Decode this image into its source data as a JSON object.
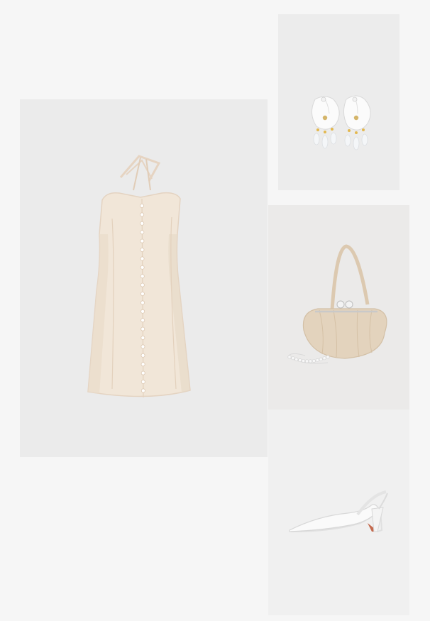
{
  "page": {
    "background": "#f6f6f6"
  },
  "products": [
    {
      "id": "dress",
      "item": "halter-neck-button-front-mini-dress",
      "color": "#f0e4d6"
    },
    {
      "id": "earrings",
      "item": "flower-drop-earrings",
      "color": "#ffffff"
    },
    {
      "id": "bag",
      "item": "pleated-frame-clutch-bag",
      "color": "#e3d3bd"
    },
    {
      "id": "shoe",
      "item": "pointed-slingback-pumps",
      "color": "#fafafa"
    }
  ]
}
